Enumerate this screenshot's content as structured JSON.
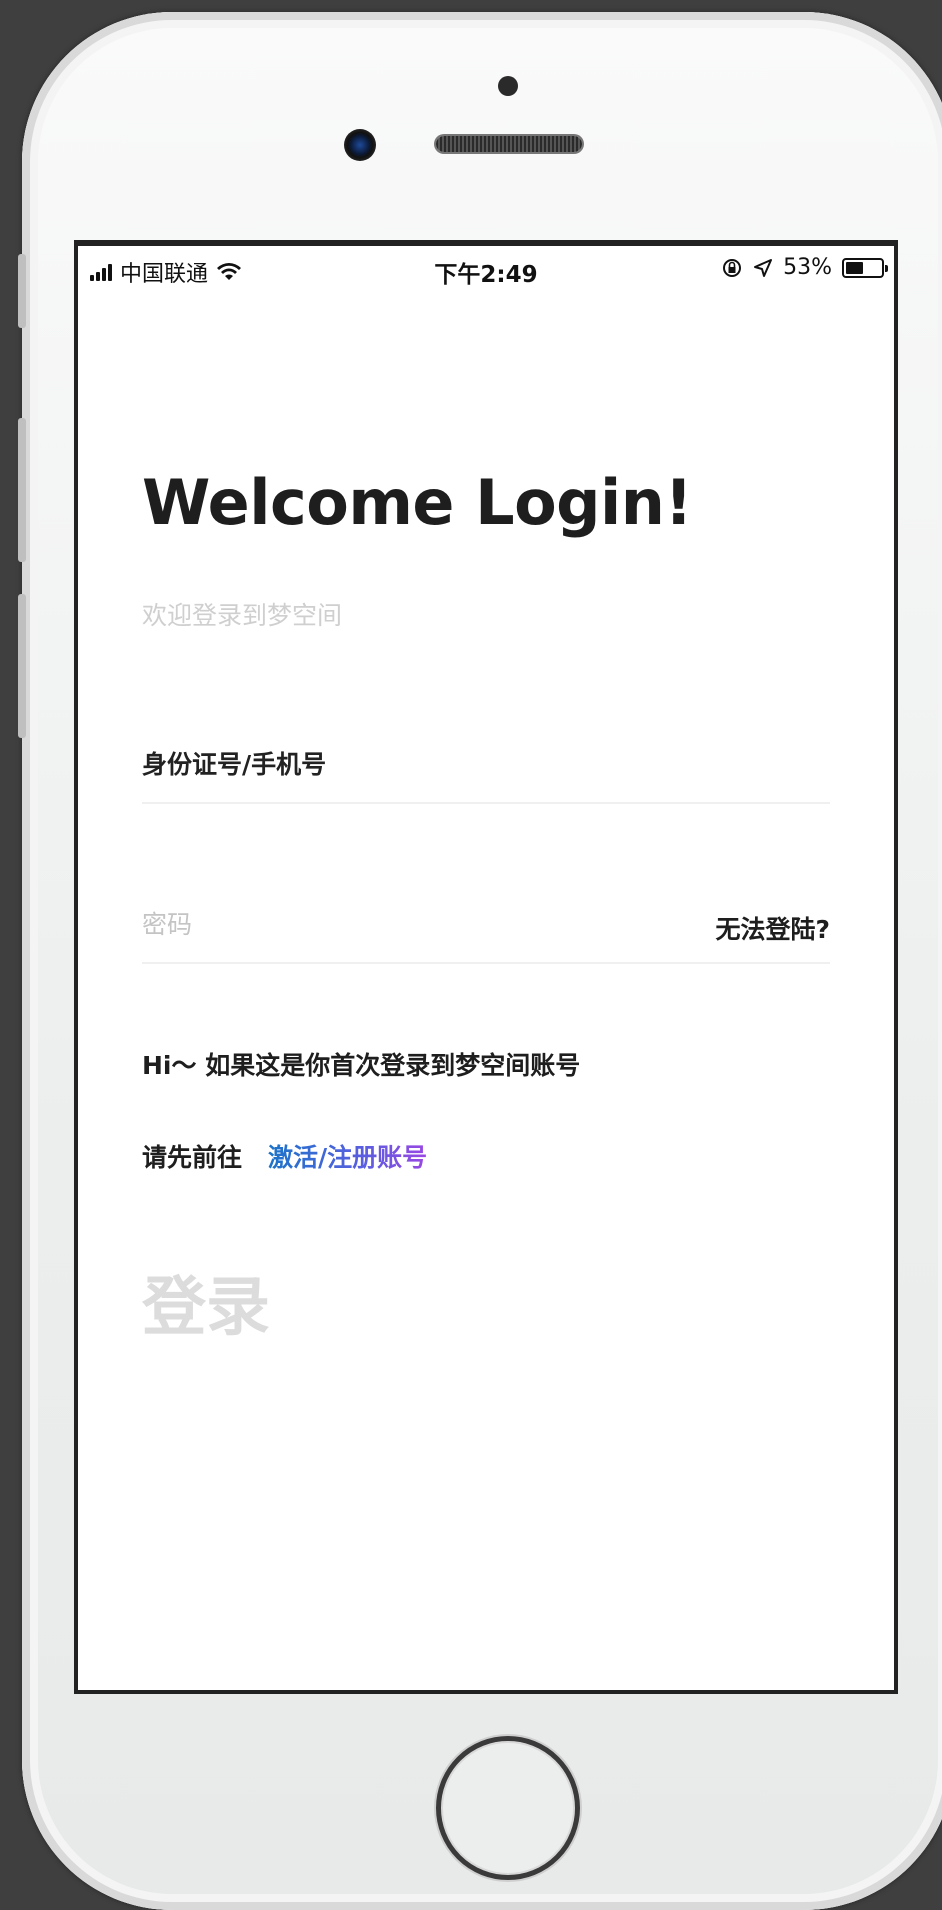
{
  "status_bar": {
    "carrier": "中国联通",
    "time": "下午2:49",
    "battery_percent": "53%",
    "battery_level": 0.53
  },
  "login": {
    "title": "Welcome Login!",
    "subtitle": "欢迎登录到梦空间",
    "id_field_placeholder": "身份证号/手机号",
    "password_placeholder": "密码",
    "forgot_label": "无法登陆?",
    "first_time_text": "Hi～ 如果这是你首次登录到梦空间账号",
    "goto_prefix": "请先前往",
    "activate_link": "激活/注册账号",
    "login_button": "登录"
  },
  "colors": {
    "link_gradient_start": "#1b74c9",
    "link_gradient_end": "#9a47e2",
    "disabled_button": "#dcdcdc",
    "placeholder": "#c4c4c4"
  }
}
